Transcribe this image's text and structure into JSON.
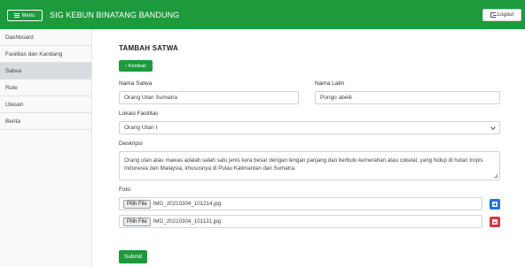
{
  "navbar": {
    "menu_label": "Menu",
    "brand": "SIG KEBUN BINATANG BANDUNG",
    "logout_label": "Logout"
  },
  "sidebar": {
    "items": [
      {
        "label": "Dashboard"
      },
      {
        "label": "Fasilitas dan Kandang"
      },
      {
        "label": "Satwa",
        "active": true
      },
      {
        "label": "Rute"
      },
      {
        "label": "Ulasan"
      },
      {
        "label": "Berita"
      }
    ]
  },
  "form": {
    "title": "TAMBAH SATWA",
    "back_label": "Kembali",
    "nama_satwa_label": "Nama Satwa",
    "nama_satwa_value": "Orang Utan Sumatra",
    "nama_latin_label": "Nama Latin",
    "nama_latin_value": "Pongo abelii",
    "lokasi_label": "Lokasi Fasilitas",
    "lokasi_value": "Orang Utan I",
    "deskripsi_label": "Deskripsi",
    "deskripsi_value": "Orang utan atau mawas adalah salah satu jenis kera besar dengan lengan panjang dan berbulu kemerahan atau cokelat, yang hidup di hutan tropis Indonesia dan Malaysia, khususnya di Pulau Kalimantan dan Sumatra.",
    "foto_label": "Foto",
    "files": [
      {
        "button": "Pilih File",
        "name": "IMG_20210304_101214.jpg"
      },
      {
        "button": "Pilih File",
        "name": "IMG_20210304_101131.jpg"
      }
    ],
    "submit_label": "Submit"
  }
}
